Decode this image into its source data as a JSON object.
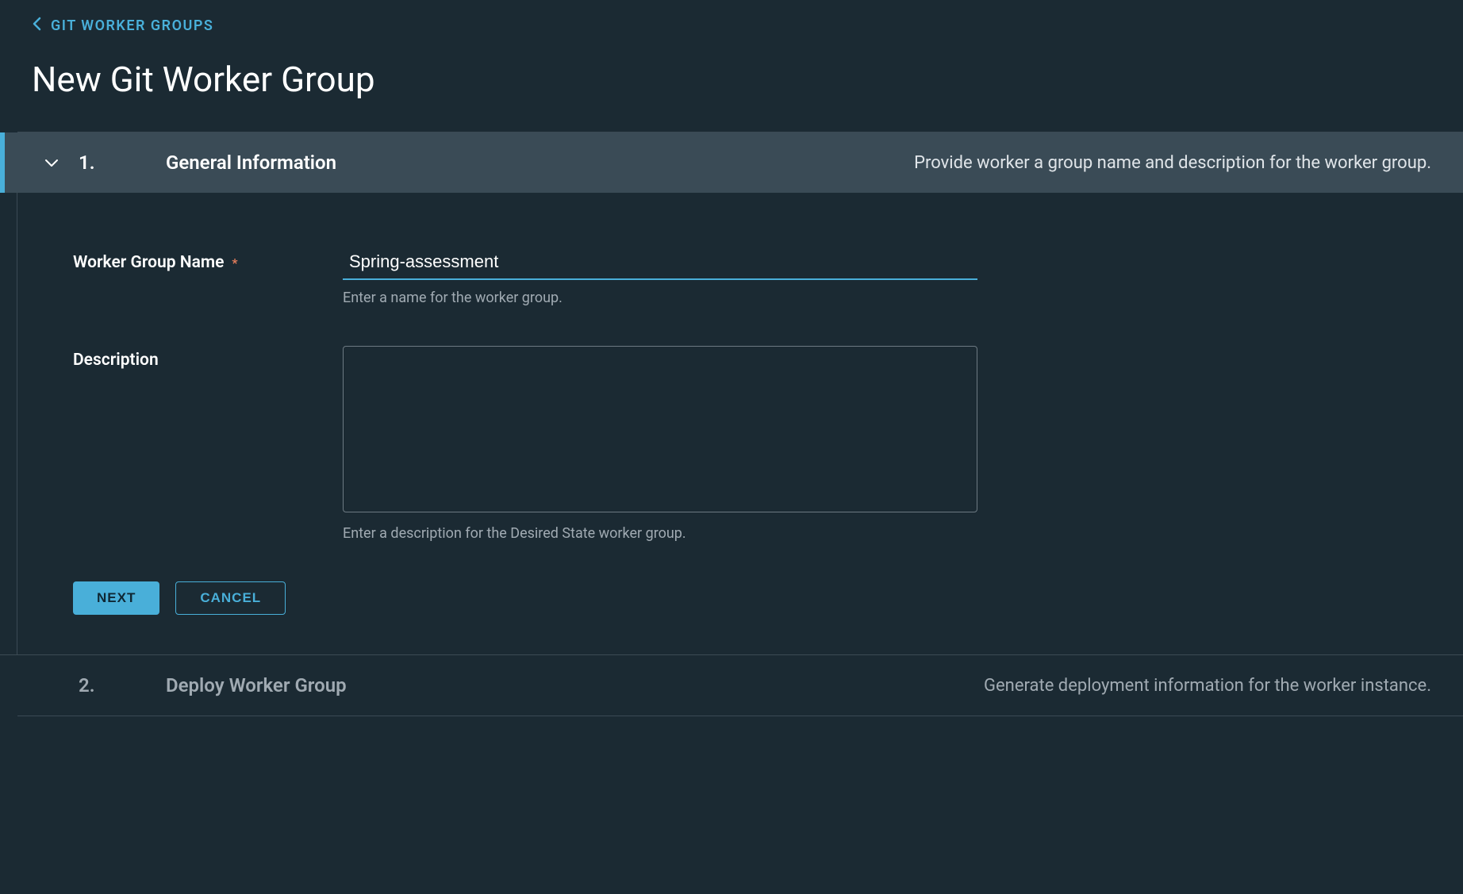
{
  "breadcrumb": {
    "label": "GIT WORKER GROUPS"
  },
  "page": {
    "title": "New Git Worker Group"
  },
  "steps": [
    {
      "number": "1.",
      "title": "General Information",
      "description": "Provide worker a group name and description for the worker group."
    },
    {
      "number": "2.",
      "title": "Deploy Worker Group",
      "description": "Generate deployment information for the worker instance."
    }
  ],
  "form": {
    "nameLabel": "Worker Group Name",
    "nameValue": "Spring-assessment",
    "nameHelp": "Enter a name for the worker group.",
    "descLabel": "Description",
    "descValue": "",
    "descHelp": "Enter a description for the Desired State worker group."
  },
  "buttons": {
    "next": "NEXT",
    "cancel": "CANCEL"
  }
}
